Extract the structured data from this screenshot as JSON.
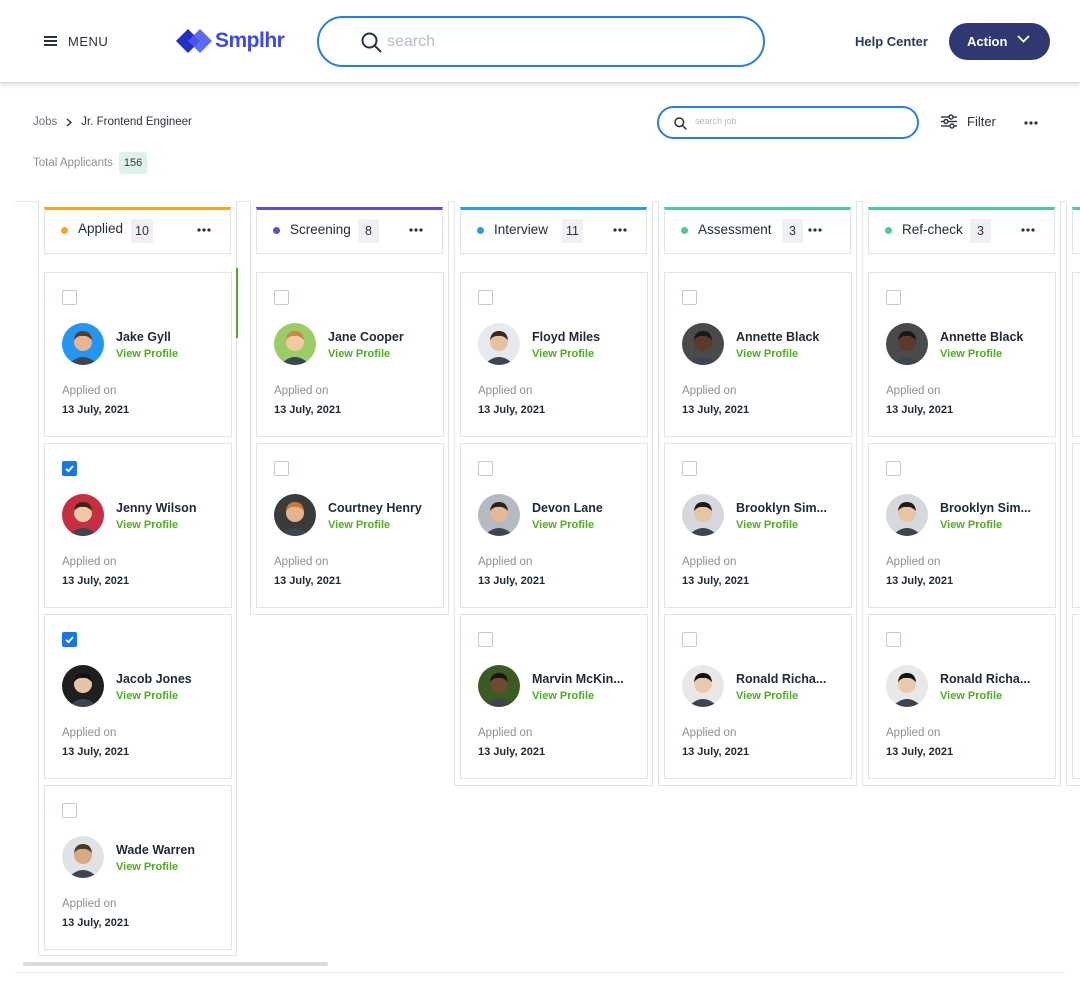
{
  "header": {
    "menu_label": "MENU",
    "logo_text": "Smplhr",
    "search_placeholder": "search",
    "help_label": "Help Center",
    "action_label": "Action"
  },
  "subheader": {
    "breadcrumb": [
      "Jobs",
      "Jr. Frontend Engineer"
    ],
    "total_label": "Total Applicants",
    "total_count": "156",
    "job_search_placeholder": "search job",
    "filter_label": "Filter"
  },
  "colors": {
    "accent": "#2f3870",
    "link_green": "#4caf1f",
    "focus_blue": "#2a7de1"
  },
  "columns": [
    {
      "title": "Applied",
      "count": "10",
      "color": "#f5a623",
      "cards": [
        {
          "name": "Jake Gyll",
          "link": "View Profile",
          "applied_label": "Applied on",
          "date": "13 July, 2021",
          "checked": false
        },
        {
          "name": "Jenny Wilson",
          "link": "View Profile",
          "applied_label": "Applied on",
          "date": "13 July, 2021",
          "checked": true
        },
        {
          "name": "Jacob Jones",
          "link": "View Profile",
          "applied_label": "Applied on",
          "date": "13 July, 2021",
          "checked": true
        },
        {
          "name": "Wade Warren",
          "link": "View Profile",
          "applied_label": "Applied on",
          "date": "13 July, 2021",
          "checked": false
        }
      ]
    },
    {
      "title": "Screening",
      "count": "8",
      "color": "#5b4fd6",
      "cards": [
        {
          "name": "Jane Cooper",
          "link": "View Profile",
          "applied_label": "Applied on",
          "date": "13 July, 2021",
          "checked": false
        },
        {
          "name": "Courtney Henry",
          "link": "View Profile",
          "applied_label": "Applied on",
          "date": "13 July, 2021",
          "checked": false
        }
      ]
    },
    {
      "title": "Interview",
      "count": "11",
      "color": "#2d9be8",
      "cards": [
        {
          "name": "Floyd Miles",
          "link": "View Profile",
          "applied_label": "Applied on",
          "date": "13 July, 2021",
          "checked": false
        },
        {
          "name": "Devon Lane",
          "link": "View Profile",
          "applied_label": "Applied on",
          "date": "13 July, 2021",
          "checked": false
        },
        {
          "name": "Marvin McKin...",
          "link": "View Profile",
          "applied_label": "Applied on",
          "date": "13 July, 2021",
          "checked": false
        }
      ]
    },
    {
      "title": "Assessment",
      "count": "3",
      "color": "#4ec99a",
      "cards": [
        {
          "name": "Annette Black",
          "link": "View Profile",
          "applied_label": "Applied on",
          "date": "13 July, 2021",
          "checked": false
        },
        {
          "name": "Brooklyn Sim...",
          "link": "View Profile",
          "applied_label": "Applied on",
          "date": "13 July, 2021",
          "checked": false
        },
        {
          "name": "Ronald Richa...",
          "link": "View Profile",
          "applied_label": "Applied on",
          "date": "13 July, 2021",
          "checked": false
        }
      ]
    },
    {
      "title": "Ref-check",
      "count": "3",
      "color": "#4ec99a",
      "cards": [
        {
          "name": "Annette Black",
          "link": "View Profile",
          "applied_label": "Applied on",
          "date": "13 July, 2021",
          "checked": false
        },
        {
          "name": "Brooklyn Sim...",
          "link": "View Profile",
          "applied_label": "Applied on",
          "date": "13 July, 2021",
          "checked": false
        },
        {
          "name": "Ronald Richa...",
          "link": "View Profile",
          "applied_label": "Applied on",
          "date": "13 July, 2021",
          "checked": false
        }
      ]
    }
  ]
}
